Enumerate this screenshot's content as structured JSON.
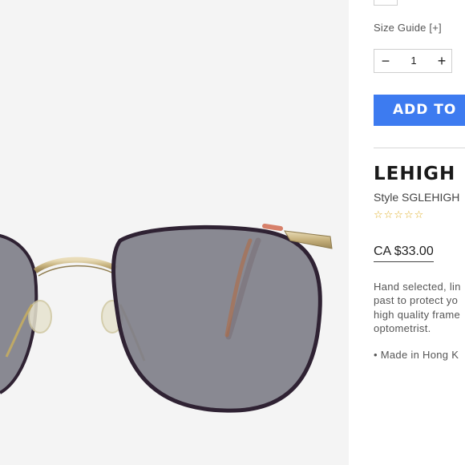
{
  "product": {
    "size_guide_label": "Size Guide [+]",
    "quantity": {
      "minus_symbol": "−",
      "value": "1",
      "plus_symbol": "+"
    },
    "add_to_cart_label": "ADD TO",
    "title": "LEHIGH",
    "style_label": "Style SGLEHIGH",
    "rating": {
      "stars_display": "☆☆☆☆☆",
      "value": 0,
      "max": 5
    },
    "price": "CA $33.00",
    "description_lines": [
      "Hand selected, lin",
      "past to protect yo",
      "high quality frame",
      "optometrist."
    ],
    "bullets": [
      "• Made in Hong K"
    ]
  },
  "colors": {
    "accent_button": "#3d7bf0",
    "image_background": "#f4f4f4",
    "star": "#e0b12c"
  },
  "icons": [
    "minus-icon",
    "plus-icon",
    "star-icon"
  ]
}
